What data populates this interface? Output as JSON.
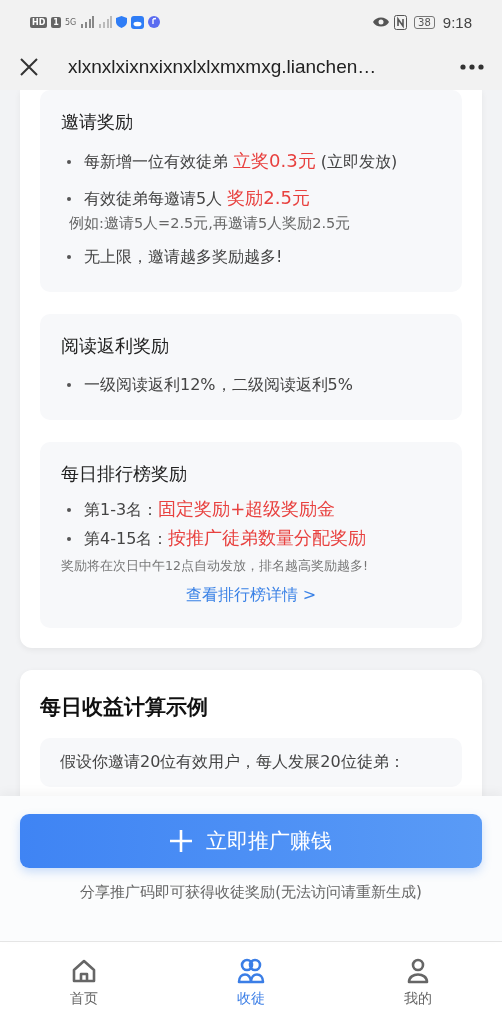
{
  "status_bar": {
    "badges": [
      "HD",
      "1"
    ],
    "network": "5G",
    "battery": "38",
    "time": "9:18"
  },
  "nav": {
    "title": "xlxnxlxixnxixnxlxlxmxmxg.lianchen…"
  },
  "reward_card": {
    "sections": [
      {
        "title": "邀请奖励",
        "items": [
          {
            "parts": [
              {
                "text": "每新增一位有效徒弟 ",
                "highlight": false
              },
              {
                "text": "立奖0.3元",
                "highlight": true
              },
              {
                "text": " (立即发放)",
                "highlight": false
              }
            ]
          },
          {
            "parts": [
              {
                "text": "有效徒弟每邀请5人 ",
                "highlight": false
              },
              {
                "text": "奖励2.5元",
                "highlight": true
              }
            ],
            "note": "例如:邀请5人=2.5元,再邀请5人奖励2.5元"
          },
          {
            "parts": [
              {
                "text": "无上限，邀请越多奖励越多!",
                "highlight": false
              }
            ]
          }
        ]
      },
      {
        "title": "阅读返利奖励",
        "items": [
          {
            "parts": [
              {
                "text": "一级阅读返利12%，二级阅读返利5%",
                "highlight": false
              }
            ]
          }
        ]
      },
      {
        "title": "每日排行榜奖励",
        "compact": true,
        "items": [
          {
            "parts": [
              {
                "text": "第1-3名：",
                "highlight": false
              },
              {
                "text": "固定奖励+超级奖励金",
                "highlight": true
              }
            ]
          },
          {
            "parts": [
              {
                "text": "第4-15名：",
                "highlight": false
              },
              {
                "text": "按推广徒弟数量分配奖励",
                "highlight": true
              }
            ]
          }
        ],
        "footnote": "奖励将在次日中午12点自动发放，排名越高奖励越多!",
        "link": "查看排行榜详情 >"
      }
    ]
  },
  "example_card": {
    "title": "每日收益计算示例",
    "text": "假设你邀请20位有效用户，每人发展20位徒弟："
  },
  "promote_button": {
    "label": "立即推广赚钱"
  },
  "hint": "分享推广码即可获得收徒奖励(无法访问请重新生成)",
  "tabs": [
    {
      "kind": "home",
      "label": "首页",
      "selected": false
    },
    {
      "kind": "group",
      "label": "收徒",
      "selected": true
    },
    {
      "kind": "person",
      "label": "我的",
      "selected": false
    }
  ]
}
